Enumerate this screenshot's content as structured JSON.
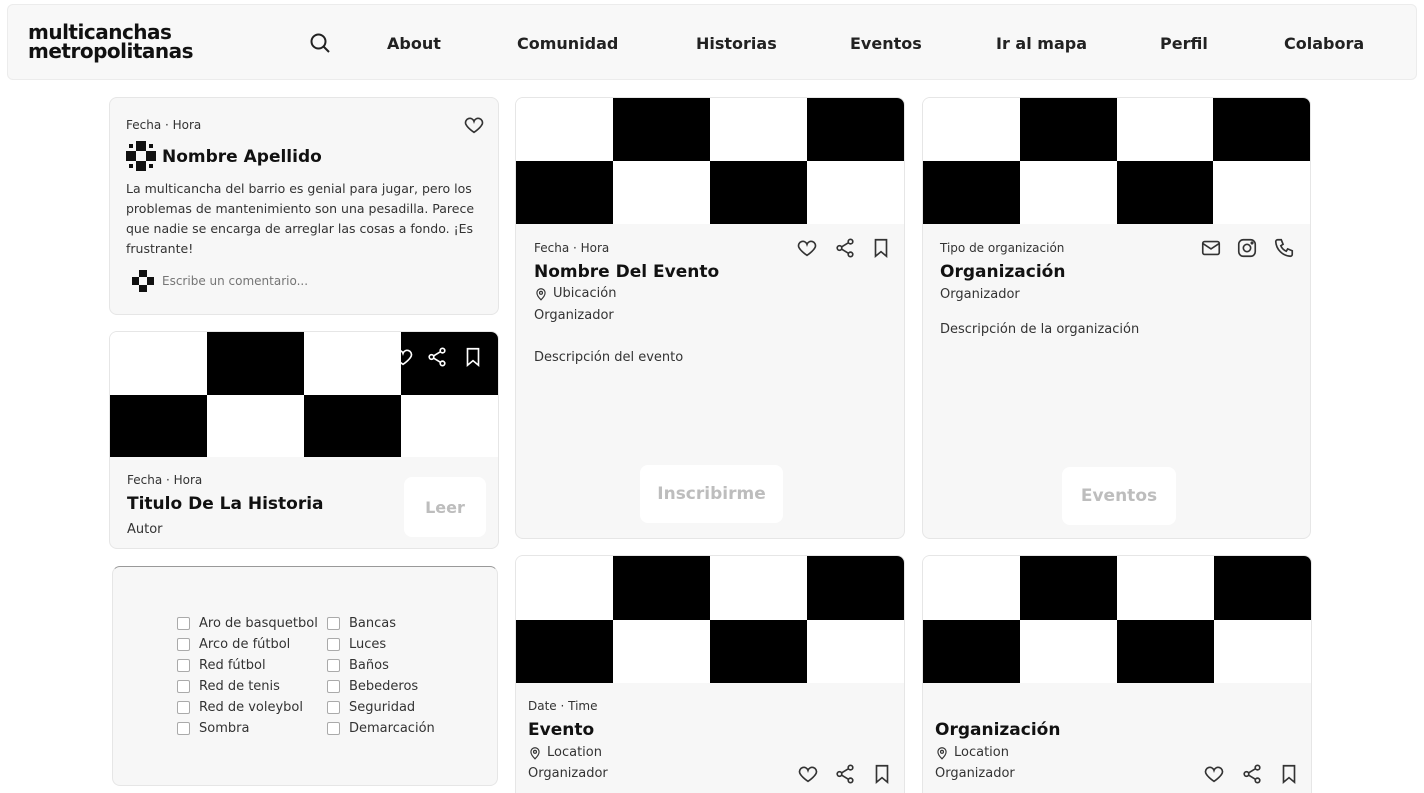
{
  "logo": {
    "line1": "multicanchas",
    "line2": "metropolitanas"
  },
  "nav": {
    "search_icon": "search-icon",
    "items": [
      "About",
      "Comunidad",
      "Historias",
      "Eventos",
      "Ir al mapa",
      "Perfil",
      "Colabora"
    ]
  },
  "comment_card": {
    "meta": "Fecha · Hora",
    "author": "Nombre Apellido",
    "text": "La multicancha del barrio es genial para jugar, pero los problemas de mantenimiento son una pesadilla. Parece que nadie se encarga de arreglar las cosas a fondo. ¡Es frustrante!",
    "comment_placeholder": "Escribe un comentario..."
  },
  "story_card": {
    "meta": "Fecha · Hora",
    "title": "Titulo De La Historia",
    "author": "Autor",
    "read_label": "Leer"
  },
  "event_card": {
    "meta": "Fecha · Hora",
    "title": "Nombre Del Evento",
    "location": "Ubicación",
    "organizer": "Organizador",
    "description": "Descripción del evento",
    "button": "Inscribirme"
  },
  "org_card": {
    "meta": "Tipo de organización",
    "title": "Organización",
    "organizer": "Organizador",
    "description": "Descripción de la organización",
    "button": "Eventos"
  },
  "event_small": {
    "meta": "Date · Time",
    "title": "Evento",
    "location": "Location",
    "organizer": "Organizador"
  },
  "org_small": {
    "title": "Organización",
    "location": "Location",
    "organizer": "Organizador"
  },
  "amenities": {
    "col1": [
      "Aro de basquetbol",
      "Arco de fútbol",
      "Red fútbol",
      "Red de tenis",
      "Red de voleybol",
      "Sombra"
    ],
    "col2": [
      "Bancas",
      "Luces",
      "Baños",
      "Bebederos",
      "Seguridad",
      "Demarcación"
    ]
  }
}
